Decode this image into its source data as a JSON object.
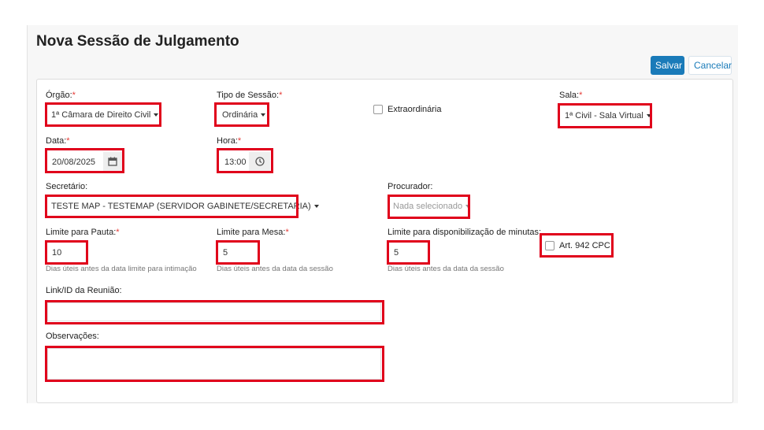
{
  "page": {
    "title": "Nova Sessão de Julgamento",
    "save_label": "Salvar",
    "cancel_label": "Cancelar"
  },
  "form": {
    "orgao": {
      "label": "Órgão:",
      "required_mark": "*",
      "value": "1ª Câmara de Direito Civil"
    },
    "tipo_sessao": {
      "label": "Tipo de Sessão:",
      "required_mark": "*",
      "value": "Ordinária"
    },
    "extraordinaria": {
      "label": "Extraordinária",
      "checked": false
    },
    "sala": {
      "label": "Sala:",
      "required_mark": "*",
      "value": "1ª Civil - Sala Virtual"
    },
    "data": {
      "label": "Data:",
      "required_mark": "*",
      "value": "20/08/2025"
    },
    "hora": {
      "label": "Hora:",
      "required_mark": "*",
      "value": "13:00"
    },
    "secretario": {
      "label": "Secretário:",
      "value": "TESTE MAP - TESTEMAP (SERVIDOR GABINETE/SECRETARIA)"
    },
    "procurador": {
      "label": "Procurador:",
      "placeholder": "Nada selecionado"
    },
    "limite_pauta": {
      "label": "Limite para Pauta:",
      "required_mark": "*",
      "value": "10",
      "hint": "Dias úteis antes da data limite para intimação"
    },
    "limite_mesa": {
      "label": "Limite para Mesa:",
      "required_mark": "*",
      "value": "5",
      "hint": "Dias úteis antes da data da sessão"
    },
    "limite_minutas": {
      "label": "Limite para disponibilização de minutas:",
      "value": "5",
      "hint": "Dias úteis antes da data da sessão"
    },
    "art942": {
      "label": "Art. 942 CPC",
      "checked": false
    },
    "link_reuniao": {
      "label": "Link/ID da Reunião:",
      "value": ""
    },
    "observacoes": {
      "label": "Observações:",
      "value": ""
    }
  },
  "colors": {
    "primary": "#1a7bb9",
    "highlight": "#e0001b",
    "required": "#e53935"
  }
}
